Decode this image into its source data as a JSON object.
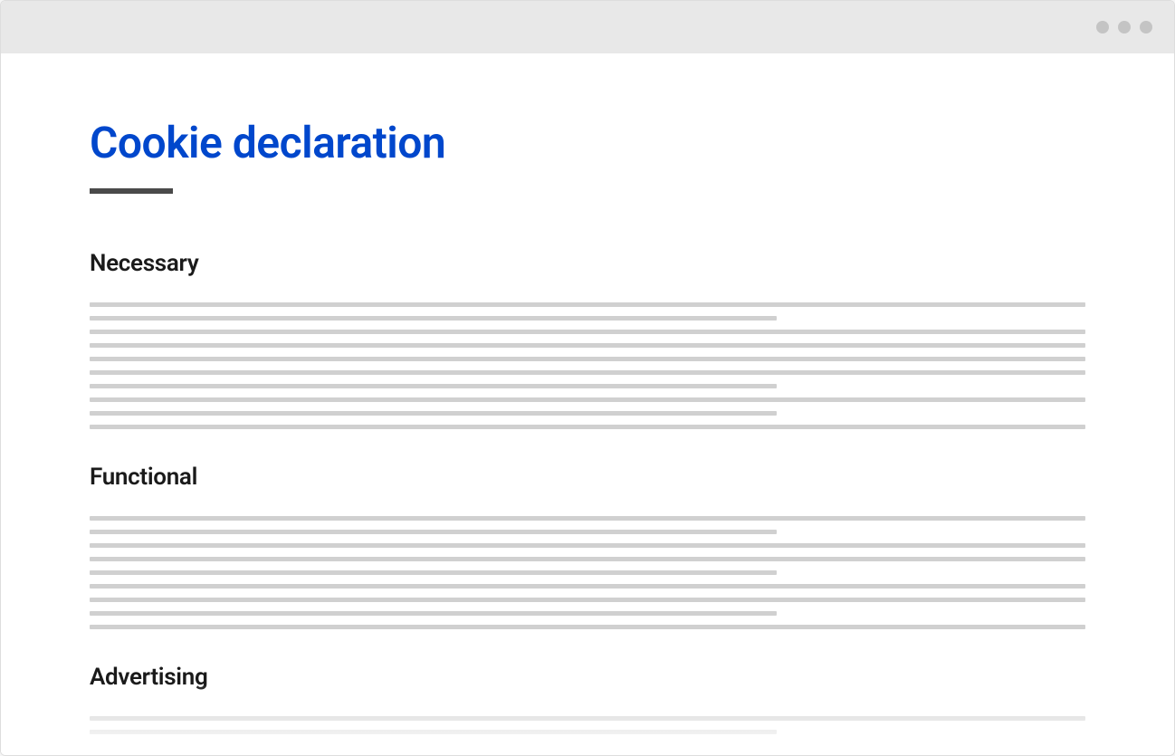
{
  "page": {
    "title": "Cookie declaration"
  },
  "sections": [
    {
      "heading": "Necessary"
    },
    {
      "heading": "Functional"
    },
    {
      "heading": "Advertising"
    }
  ]
}
